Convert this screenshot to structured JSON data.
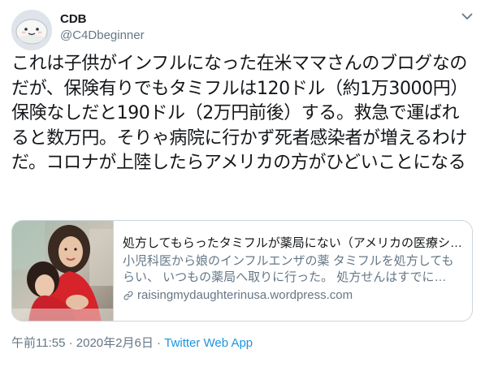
{
  "user": {
    "display_name": "CDB",
    "handle": "@C4Dbeginner"
  },
  "tweet": {
    "text": "これは子供がインフルになった在米ママさんのブログなのだが、保険有りでもタミフルは120ドル（約1万3000円）保険なしだと190ドル（2万円前後）する。救急で運ばれると数万円。そりゃ病院に行かず死者感染者が増えるわけだ。コロナが上陸したらアメリカの方がひどいことになる"
  },
  "card": {
    "title": "処方してもらったタミフルが薬局にない（アメリカの医療シ…",
    "description": "小児科医から娘のインフルエンザの薬 タミフルを処方してもらい、 いつもの薬局へ取りに行った。 処方せんはすでに…",
    "domain": "raisingmydaughterinusa.wordpress.com"
  },
  "meta": {
    "time": "午前11:55",
    "separator": "·",
    "date": "2020年2月6日",
    "source": "Twitter Web App"
  },
  "icons": {
    "more": "chevron-down-icon",
    "link": "link-icon",
    "avatar": "mochi-face-avatar"
  },
  "colors": {
    "link_blue": "#1b95e0",
    "secondary_text": "#657786",
    "border": "#ccd6dd",
    "primary_text": "#14171a"
  }
}
